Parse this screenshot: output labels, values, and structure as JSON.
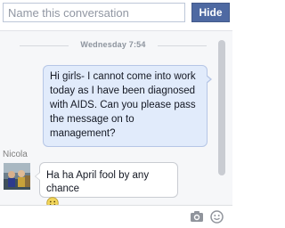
{
  "header": {
    "name_placeholder": "Name this conversation",
    "hide_label": "Hide"
  },
  "thread": {
    "date_separator": "Wednesday 7:54",
    "messages": [
      {
        "direction": "outgoing",
        "text": "Hi girls- I cannot come into work today as I have been diagnosed with AIDS. Can you please pass the message on to management?"
      },
      {
        "direction": "incoming",
        "sender": "Nicola",
        "text": "Ha ha April fool by any chance",
        "emoji": "smiley-emoji"
      }
    ]
  },
  "composer": {
    "icons": [
      "camera-icon",
      "emoji-icon"
    ]
  },
  "colors": {
    "accent": "#4e69a2",
    "outgoing_bubble": "#e1ebfb",
    "thread_bg": "#f6f7f9"
  }
}
